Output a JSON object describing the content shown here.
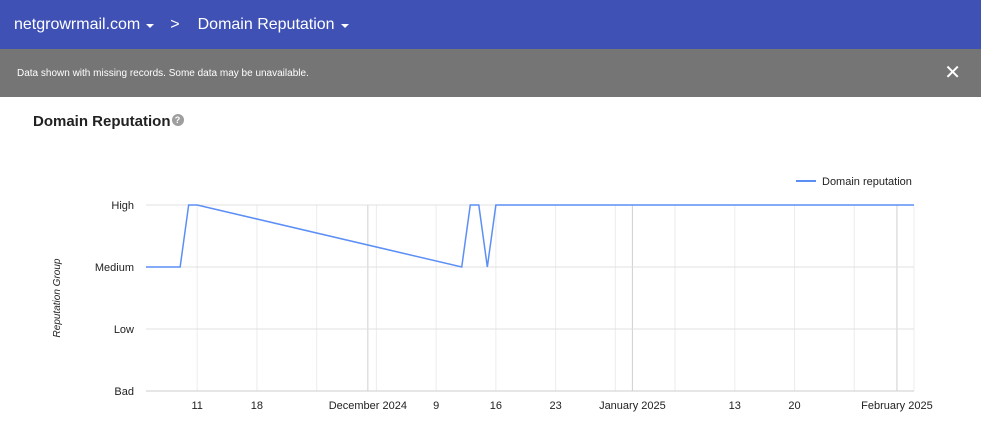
{
  "header": {
    "domain": "netgrowrmail.com",
    "separator": ">",
    "page": "Domain Reputation"
  },
  "banner": {
    "message": "Data shown with missing records. Some data may be unavailable.",
    "close": "✕"
  },
  "section": {
    "title": "Domain Reputation",
    "help": "?"
  },
  "chart_data": {
    "type": "line",
    "title": "Domain Reputation",
    "ylabel": "Reputation Group",
    "y_categories": [
      "Bad",
      "Low",
      "Medium",
      "High"
    ],
    "x_range": [
      "2024-11-05",
      "2025-02-03"
    ],
    "x_ticks": [
      {
        "date": "2024-11-11",
        "label": "11"
      },
      {
        "date": "2024-11-18",
        "label": "18"
      },
      {
        "date": "2024-12-01",
        "label": "December 2024"
      },
      {
        "date": "2024-12-09",
        "label": "9"
      },
      {
        "date": "2024-12-16",
        "label": "16"
      },
      {
        "date": "2024-12-23",
        "label": "23"
      },
      {
        "date": "2025-01-01",
        "label": "January 2025"
      },
      {
        "date": "2025-01-13",
        "label": "13"
      },
      {
        "date": "2025-01-20",
        "label": "20"
      },
      {
        "date": "2025-02-01",
        "label": "February 2025"
      }
    ],
    "legend": {
      "position": "top-right",
      "label": "Domain reputation"
    },
    "series": [
      {
        "name": "Domain reputation",
        "color": "#5c8ff5",
        "points": [
          {
            "x": "2024-11-05",
            "y": "Medium"
          },
          {
            "x": "2024-11-09",
            "y": "Medium"
          },
          {
            "x": "2024-11-10",
            "y": "High"
          },
          {
            "x": "2024-11-11",
            "y": "High"
          },
          {
            "x": "2024-12-12",
            "y": "Medium"
          },
          {
            "x": "2024-12-13",
            "y": "High"
          },
          {
            "x": "2024-12-14",
            "y": "High"
          },
          {
            "x": "2024-12-15",
            "y": "Medium"
          },
          {
            "x": "2024-12-16",
            "y": "High"
          },
          {
            "x": "2025-02-03",
            "y": "High"
          }
        ]
      }
    ]
  }
}
